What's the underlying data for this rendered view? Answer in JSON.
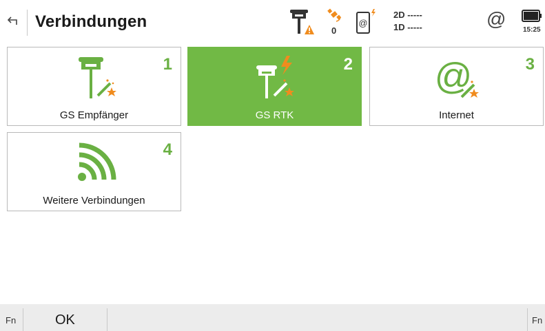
{
  "header": {
    "title": "Verbindungen",
    "satellite_count": "0",
    "quality_2d": "2D -----",
    "quality_1d": "1D -----",
    "at_symbol": "@",
    "time": "15:25",
    "icons": [
      "back-arrow-icon",
      "rover-warning-icon",
      "satellite-icon",
      "device-connection-icon",
      "at-icon",
      "battery-icon"
    ]
  },
  "tiles": [
    {
      "number": "1",
      "label": "GS Empfänger",
      "icon": "gnss-receiver-wand-icon",
      "active": false
    },
    {
      "number": "2",
      "label": "GS RTK",
      "icon": "rtk-receiver-wand-icon",
      "active": true
    },
    {
      "number": "3",
      "label": "Internet",
      "icon": "internet-at-wand-icon",
      "active": false
    },
    {
      "number": "4",
      "label": "Weitere Verbindungen",
      "icon": "wireless-signal-icon",
      "active": false
    }
  ],
  "colors": {
    "accent_green": "#71b945",
    "icon_green": "#6ab043",
    "warning_orange": "#f08c1e"
  },
  "footer": {
    "fn_left": "Fn",
    "ok_label": "OK",
    "fn_right": "Fn"
  }
}
